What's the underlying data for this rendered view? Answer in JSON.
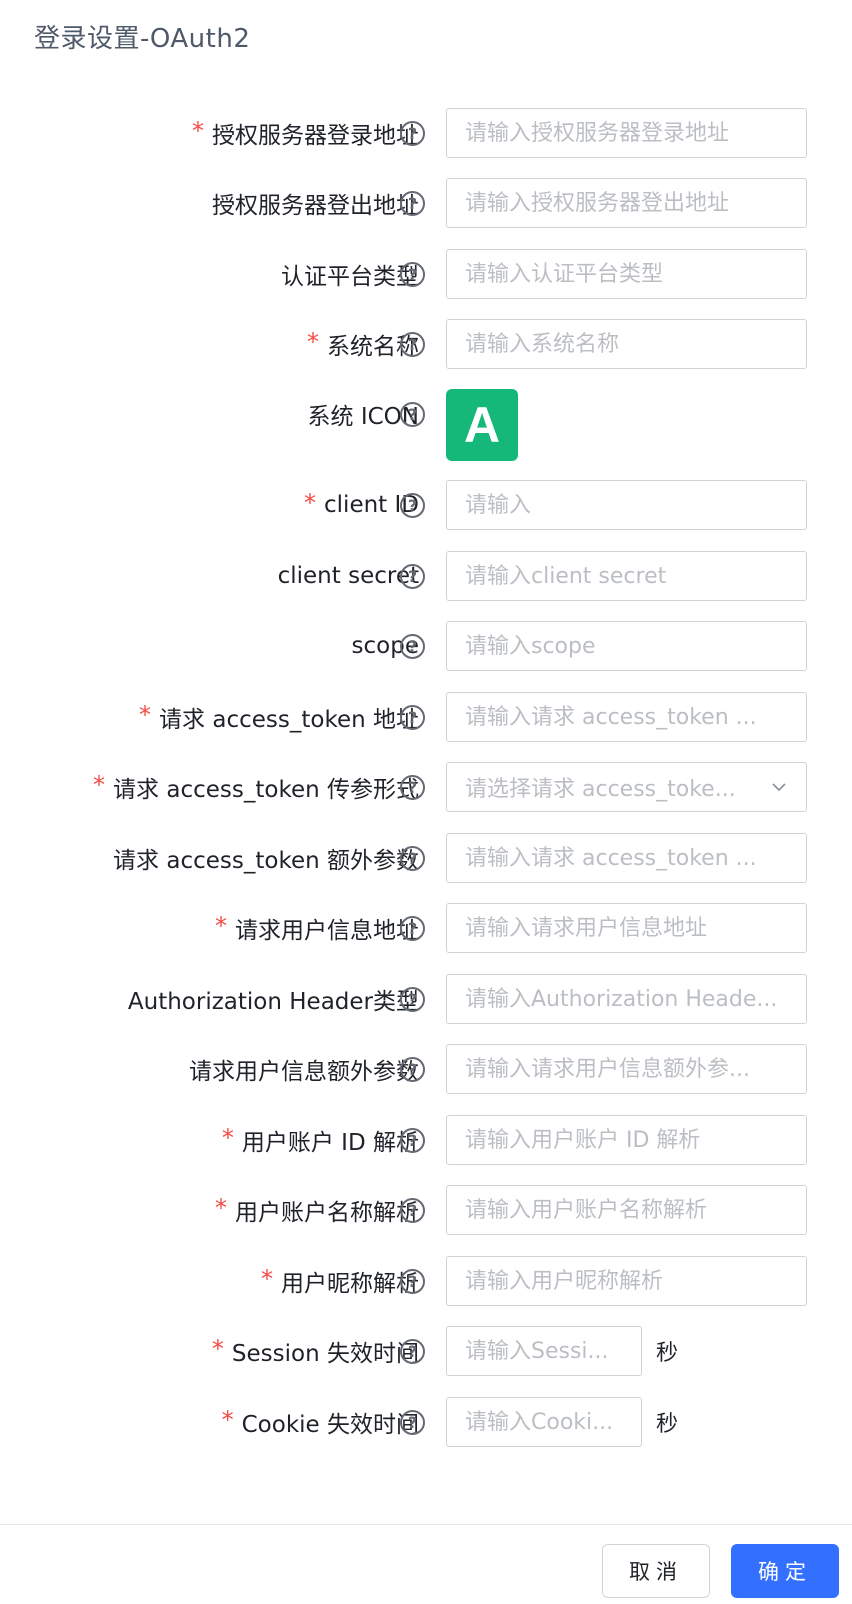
{
  "dialog": {
    "title": "登录设置-OAuth2"
  },
  "help_glyph": "?",
  "required_mark": "*",
  "fields": {
    "auth_login_url": {
      "label": "授权服务器登录地址",
      "placeholder": "请输入授权服务器登录地址"
    },
    "auth_logout_url": {
      "label": "授权服务器登出地址",
      "placeholder": "请输入授权服务器登出地址"
    },
    "platform_type": {
      "label": "认证平台类型",
      "placeholder": "请输入认证平台类型"
    },
    "system_name": {
      "label": "系统名称",
      "placeholder": "请输入系统名称"
    },
    "system_icon": {
      "label": "系统 ICON",
      "icon_letter": "A",
      "icon_color": "#16b87a"
    },
    "client_id": {
      "label": "client ID",
      "placeholder": "请输入"
    },
    "client_secret": {
      "label": "client secret",
      "placeholder": "请输入client secret"
    },
    "scope": {
      "label": "scope",
      "placeholder": "请输入scope"
    },
    "token_url": {
      "label": "请求 access_token 地址",
      "placeholder": "请输入请求 access_token ..."
    },
    "token_param_mode": {
      "label": "请求 access_token 传参形式",
      "placeholder": "请选择请求 access_toke..."
    },
    "token_extra_params": {
      "label": "请求 access_token 额外参数",
      "placeholder": "请输入请求 access_token ..."
    },
    "userinfo_url": {
      "label": "请求用户信息地址",
      "placeholder": "请输入请求用户信息地址"
    },
    "auth_header_type": {
      "label": "Authorization Header类型",
      "placeholder": "请输入Authorization Heade..."
    },
    "userinfo_extra_params": {
      "label": "请求用户信息额外参数",
      "placeholder": "请输入请求用户信息额外参..."
    },
    "user_id_parse": {
      "label": "用户账户 ID 解析",
      "placeholder": "请输入用户账户 ID 解析"
    },
    "user_name_parse": {
      "label": "用户账户名称解析",
      "placeholder": "请输入用户账户名称解析"
    },
    "nickname_parse": {
      "label": "用户昵称解析",
      "placeholder": "请输入用户昵称解析"
    },
    "session_timeout": {
      "label": "Session 失效时间",
      "placeholder": "请输入Sessi...",
      "unit": "秒"
    },
    "cookie_timeout": {
      "label": "Cookie 失效时间",
      "placeholder": "请输入Cooki...",
      "unit": "秒"
    }
  },
  "footer": {
    "cancel_label": "取消",
    "confirm_label": "确定"
  },
  "colors": {
    "primary": "#3370ff",
    "required": "#f54a45",
    "icon_bg": "#16b87a"
  }
}
